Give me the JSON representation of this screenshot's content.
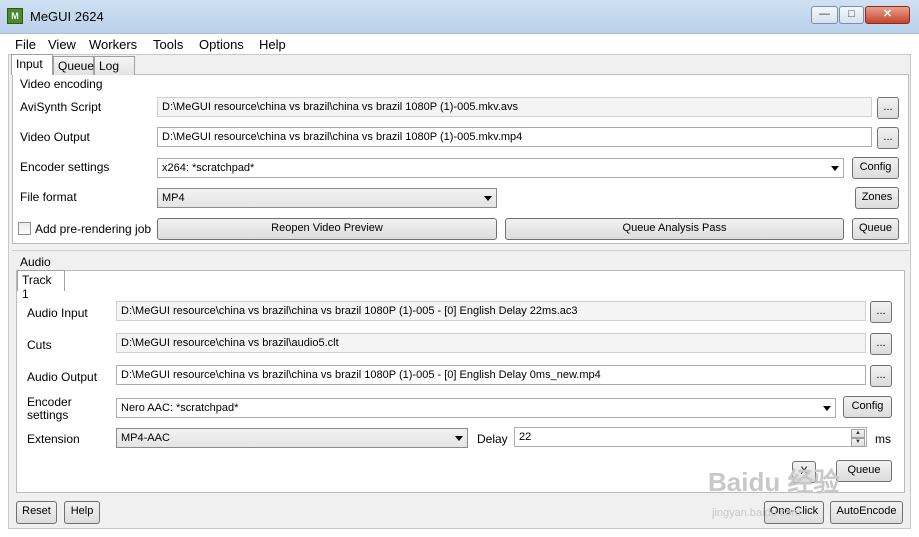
{
  "window": {
    "title": "MeGUI 2624",
    "icon_letter": "M",
    "buttons": {
      "minimize": "—",
      "maximize": "□",
      "close": "✕"
    }
  },
  "menu": [
    "File",
    "View",
    "Workers",
    "Tools",
    "Options",
    "Help"
  ],
  "tabs": [
    "Input",
    "Queue",
    "Log"
  ],
  "video": {
    "section_label": "Video encoding",
    "avisynth_label": "AviSynth Script",
    "avisynth_value": "D:\\MeGUI resource\\china vs brazil\\china vs brazil 1080P (1)-005.mkv.avs",
    "output_label": "Video Output",
    "output_value": "D:\\MeGUI resource\\china vs brazil\\china vs brazil 1080P (1)-005.mkv.mp4",
    "encoder_label": "Encoder settings",
    "encoder_value": "x264: *scratchpad*",
    "format_label": "File format",
    "format_value": "MP4",
    "browse_label": "...",
    "config_label": "Config",
    "zones_label": "Zones",
    "prerender_label": "Add pre-rendering job",
    "reopen_label": "Reopen Video Preview",
    "analysis_label": "Queue Analysis Pass",
    "queue_label": "Queue"
  },
  "audio": {
    "section_label": "Audio",
    "track_tab": "Track 1",
    "input_label": "Audio Input",
    "input_value": "D:\\MeGUI resource\\china vs brazil\\china vs brazil 1080P (1)-005 - [0] English Delay 22ms.ac3",
    "cuts_label": "Cuts",
    "cuts_value": "D:\\MeGUI resource\\china vs brazil\\audio5.clt",
    "output_label": "Audio Output",
    "output_value": "D:\\MeGUI resource\\china vs brazil\\china vs brazil 1080P (1)-005 - [0] English Delay 0ms_new.mp4",
    "encoder_label_1": "Encoder",
    "encoder_label_2": "settings",
    "encoder_value": "Nero AAC: *scratchpad*",
    "config_label": "Config",
    "extension_label": "Extension",
    "extension_value": "MP4-AAC",
    "delay_label": "Delay",
    "delay_value": "22",
    "delay_unit": "ms",
    "browse_label": "...",
    "remove_label": "X",
    "queue_label": "Queue"
  },
  "footer": {
    "reset_label": "Reset",
    "help_label": "Help",
    "oneclick_label": "One-Click",
    "autoencode_label": "AutoEncode"
  },
  "watermark": {
    "main": "Baidu 经验",
    "sub": "jingyan.baidu.com"
  }
}
